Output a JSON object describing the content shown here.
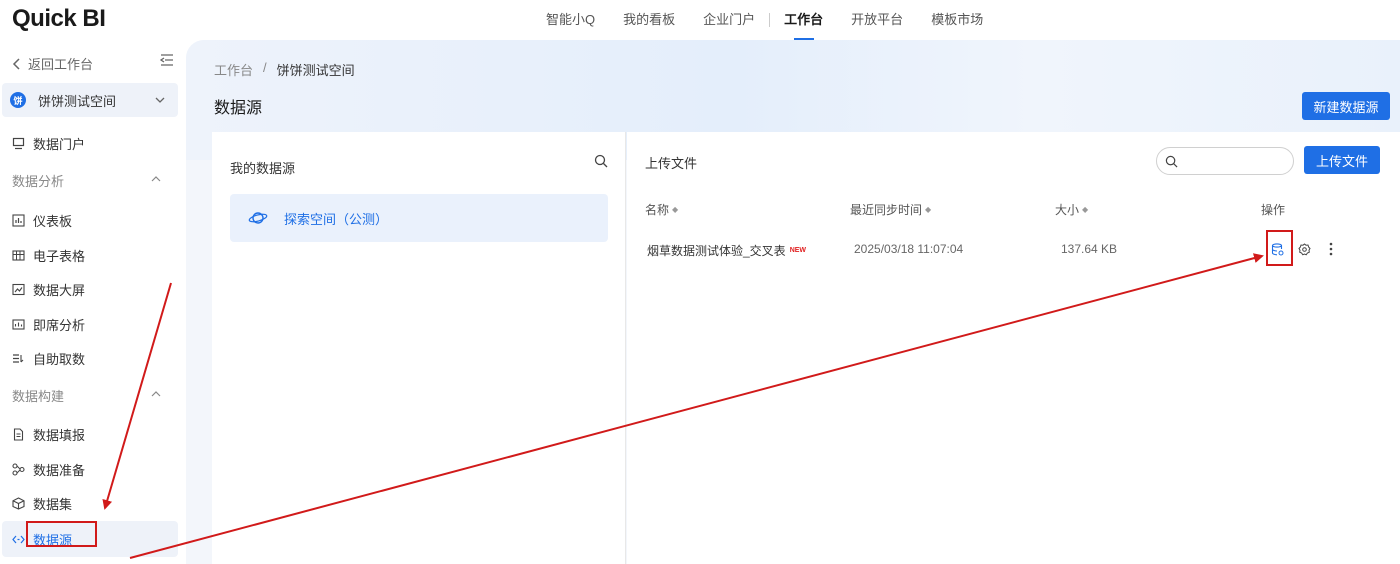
{
  "app": {
    "logo": "Quick BI"
  },
  "topnav": {
    "items": [
      "智能小Q",
      "我的看板",
      "企业门户",
      "工作台",
      "开放平台",
      "模板市场"
    ]
  },
  "sidebar": {
    "back": "返回工作台",
    "workspace": {
      "avatar": "饼",
      "name": "饼饼测试空间"
    },
    "portal": "数据门户",
    "group_analysis": "数据分析",
    "analysis_items": [
      "仪表板",
      "电子表格",
      "数据大屏",
      "即席分析",
      "自助取数"
    ],
    "group_build": "数据构建",
    "build_items": [
      "数据填报",
      "数据准备",
      "数据集",
      "数据源"
    ]
  },
  "main": {
    "breadcrumb": {
      "root": "工作台",
      "sep": "/",
      "current": "饼饼测试空间"
    },
    "title": "数据源",
    "new_button": "新建数据源",
    "left": {
      "title": "我的数据源",
      "card_label": "探索空间（公测）"
    },
    "right": {
      "title": "上传文件",
      "search_placeholder": "",
      "upload_button": "上传文件",
      "columns": {
        "name": "名称",
        "sync": "最近同步时间",
        "size": "大小",
        "ops": "操作"
      },
      "rows": [
        {
          "name": "烟草数据测试体验_交叉表",
          "tag": "NEW",
          "sync": "2025/03/18 11:07:04",
          "size": "137.64 KB"
        }
      ]
    }
  },
  "colors": {
    "accent": "#1f6fe5",
    "annotation": "#d11a1a"
  }
}
